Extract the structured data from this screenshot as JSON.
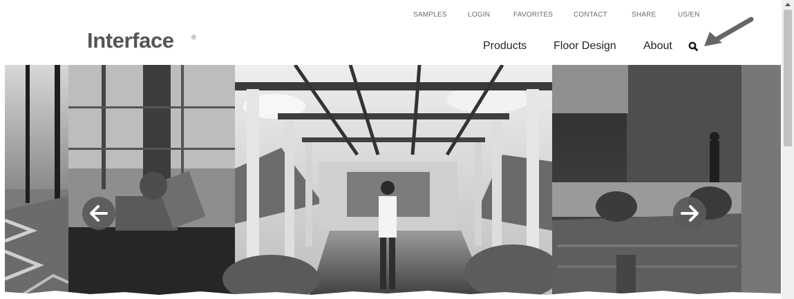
{
  "utility_nav": {
    "samples": "SAMPLES",
    "login": "LOGIN",
    "favorites": "FAVORITES",
    "contact": "CONTACT",
    "share": "SHARE",
    "locale": "US/EN"
  },
  "logo": {
    "text": "Interface",
    "mark": "®"
  },
  "main_nav": {
    "products": "Products",
    "floor_design": "Floor Design",
    "about": "About"
  },
  "icons": {
    "search": "search-icon",
    "prev": "arrow-left-icon",
    "next": "arrow-right-icon",
    "annotation": "pointer-arrow-icon"
  },
  "colors": {
    "logo": "#555555",
    "utility_text": "#6b6b6b",
    "nav_text": "#222222",
    "carousel_button": "#5a5a5a"
  }
}
